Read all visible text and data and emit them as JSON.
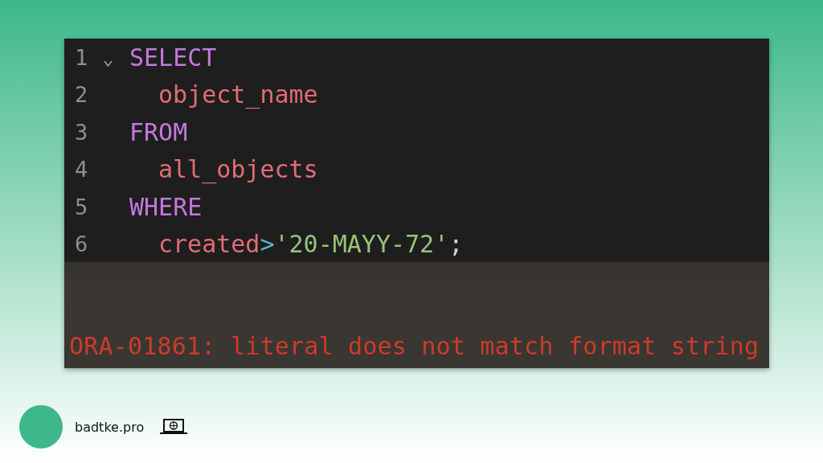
{
  "editor": {
    "lines": [
      {
        "number": "1",
        "foldable": true,
        "indented": false,
        "tokens": [
          {
            "kind": "keyword",
            "text": "SELECT"
          }
        ]
      },
      {
        "number": "2",
        "foldable": false,
        "indented": true,
        "tokens": [
          {
            "kind": "identifier",
            "text": "object_name"
          }
        ]
      },
      {
        "number": "3",
        "foldable": false,
        "indented": false,
        "tokens": [
          {
            "kind": "keyword",
            "text": "FROM"
          }
        ]
      },
      {
        "number": "4",
        "foldable": false,
        "indented": true,
        "tokens": [
          {
            "kind": "identifier",
            "text": "all_objects"
          }
        ]
      },
      {
        "number": "5",
        "foldable": false,
        "indented": false,
        "tokens": [
          {
            "kind": "keyword",
            "text": "WHERE"
          }
        ]
      },
      {
        "number": "6",
        "foldable": false,
        "indented": true,
        "tokens": [
          {
            "kind": "identifier",
            "text": "created"
          },
          {
            "kind": "operator",
            "text": ">"
          },
          {
            "kind": "string",
            "text": "'20-MAYY-72'"
          },
          {
            "kind": "punct",
            "text": ";"
          }
        ]
      }
    ]
  },
  "output": {
    "error": "ORA-01861: literal does not match format string"
  },
  "footer": {
    "site": "badtke.pro"
  }
}
